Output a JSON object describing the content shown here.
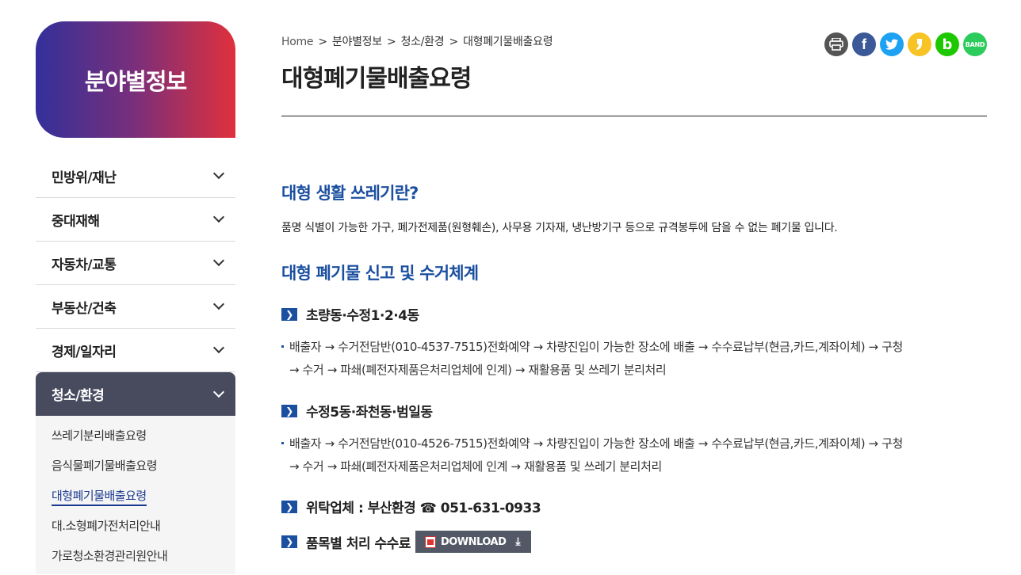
{
  "sidebar": {
    "title": "분야별정보",
    "items": [
      {
        "label": "민방위/재난"
      },
      {
        "label": "중대재해"
      },
      {
        "label": "자동차/교통"
      },
      {
        "label": "부동산/건축"
      },
      {
        "label": "경제/일자리"
      },
      {
        "label": "청소/환경",
        "active": true
      }
    ],
    "sub_items": [
      {
        "label": "쓰레기분리배출요령"
      },
      {
        "label": "음식물폐기물배출요령"
      },
      {
        "label": "대형폐기물배출요령",
        "active": true
      },
      {
        "label": "대.소형폐가전처리안내"
      },
      {
        "label": "가로청소환경관리원안내"
      }
    ]
  },
  "breadcrumb": {
    "home": "Home",
    "sep": ">",
    "level1": "분야별정보",
    "level2": "청소/환경",
    "level3": "대형폐기물배출요령"
  },
  "page_title": "대형폐기물배출요령",
  "share": {
    "print_icon": "printer-icon",
    "facebook": "f",
    "twitter_icon": "twitter-icon",
    "kakaostory_icon": "kakaostory-icon",
    "blog": "b",
    "band": "BAND"
  },
  "content": {
    "section1_title": "대형 생활 쓰레기란?",
    "section1_desc": "품명 식별이 가능한 가구, 폐가전제품(원형훼손), 사무용 기자재, 냉난방기구 등으로 규격봉투에 담을 수 없는 폐기물 입니다.",
    "section2_title": "대형 폐기물 신고 및 수거체계",
    "areas": [
      {
        "name": "초량동·수정1·2·4동",
        "line1": "배출자 → 수거전담반(010-4537-7515)전화예약 → 차량진입이 가능한 장소에 배출 → 수수료납부(현금,카드,계좌이체) → 구청",
        "line2": "→ 수거 → 파쇄(폐전자제품은처리업체에 인계) → 재활용품 및 쓰레기 분리처리"
      },
      {
        "name": "수정5동·좌천동·범일동",
        "line1": "배출자 → 수거전담반(010-4526-7515)전화예약 → 차량진입이 가능한 장소에 배출 → 수수료납부(현금,카드,계좌이체) → 구청",
        "line2": "→ 수거 → 파쇄(폐전자제품은처리업체에 인계 → 재활용품 및 쓰레기 분리처리"
      }
    ],
    "contractor": "위탁업체 : 부산환경 ☎ 051-631-0933",
    "fee_label": "품목별 처리 수수료",
    "download_label": "DOWNLOAD"
  },
  "colors": {
    "accent": "#1b4fa0",
    "sidebar_active": "#484a5e",
    "title_gradient_start": "#33309a",
    "title_gradient_end": "#e0303c"
  }
}
